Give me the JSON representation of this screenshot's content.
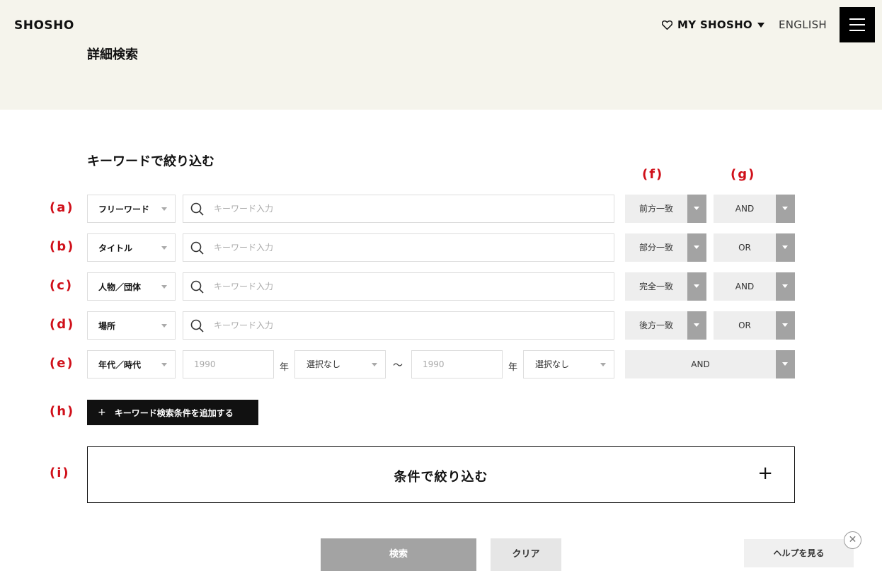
{
  "header": {
    "logo": "SHOSHO",
    "page_title": "詳細検索",
    "my_shosho": "MY SHOSHO",
    "english": "ENGLISH"
  },
  "keyword_section": {
    "title": "キーワードで絞り込む",
    "col_labels": {
      "match": "(f)",
      "logic": "(g)"
    },
    "rows": [
      {
        "label": "(a)",
        "field": "フリーワード",
        "placeholder": "キーワード入力",
        "match": "前方一致",
        "logic": "AND"
      },
      {
        "label": "(b)",
        "field": "タイトル",
        "placeholder": "キーワード入力",
        "match": "部分一致",
        "logic": "OR"
      },
      {
        "label": "(c)",
        "field": "人物／団体",
        "placeholder": "キーワード入力",
        "match": "完全一致",
        "logic": "AND"
      },
      {
        "label": "(d)",
        "field": "場所",
        "placeholder": "キーワード入力",
        "match": "後方一致",
        "logic": "OR"
      }
    ],
    "era_row": {
      "label": "(e)",
      "field": "年代／時代",
      "from_year_placeholder": "1990",
      "year_unit": "年",
      "from_era": "選択なし",
      "tilde": "〜",
      "to_year_placeholder": "1990",
      "to_era": "選択なし",
      "logic": "AND"
    },
    "add_label": "(h)",
    "add_button": "キーワード検索条件を追加する",
    "add_plus": "+"
  },
  "condition_section": {
    "label": "(i)",
    "title": "条件で絞り込む",
    "plus": "+"
  },
  "footer": {
    "search": "検索",
    "clear": "クリア",
    "help": "ヘルプを見る",
    "close": "✕"
  }
}
